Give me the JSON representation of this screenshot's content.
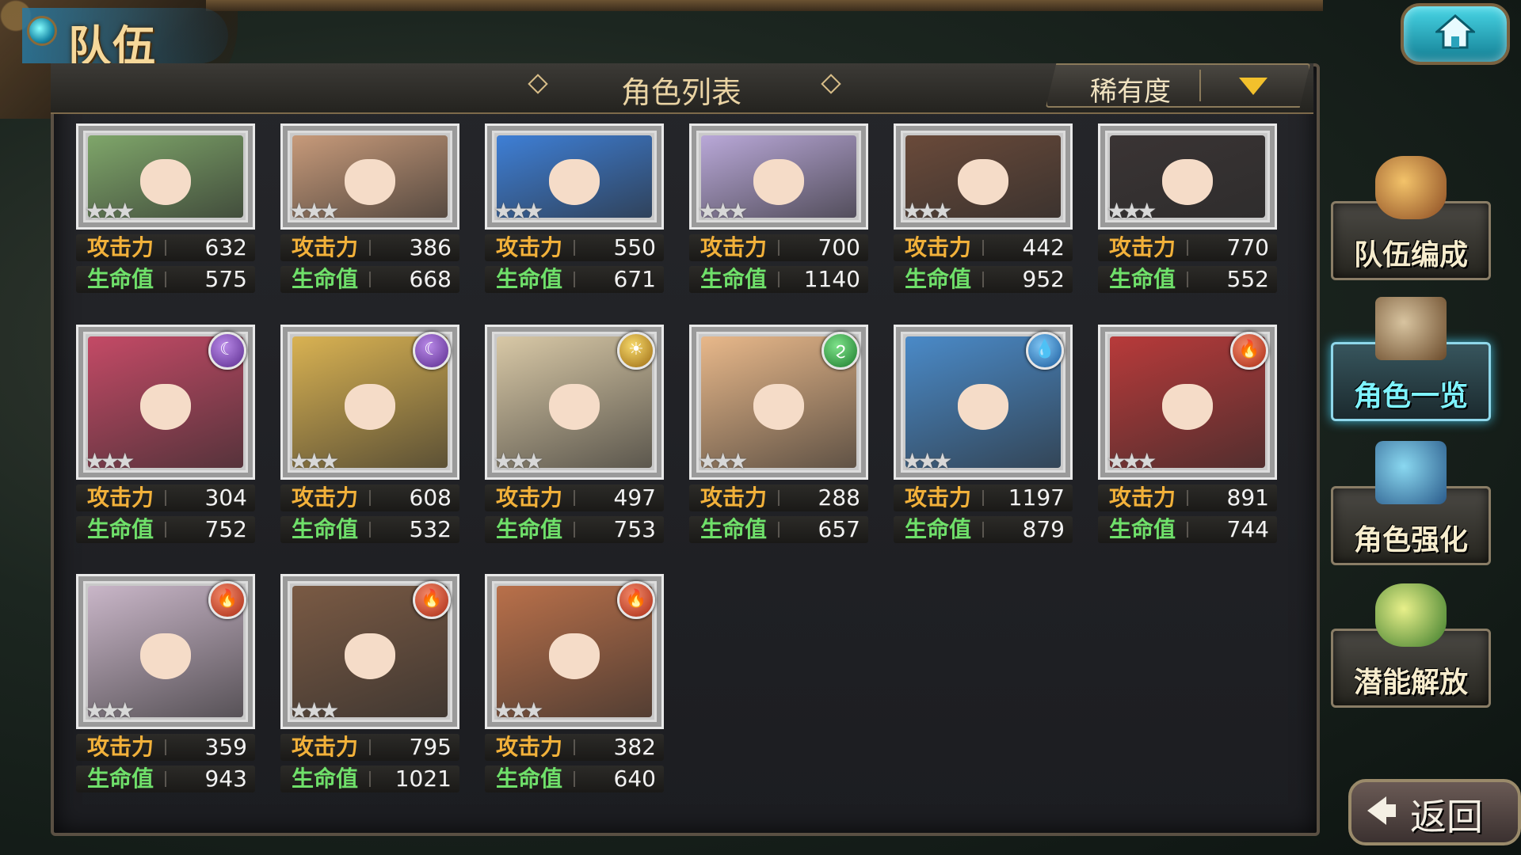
{
  "header": {
    "title": "队伍"
  },
  "panel": {
    "title": "角色列表",
    "sort_label": "稀有度"
  },
  "stat_labels": {
    "atk": "攻击力",
    "hp": "生命值"
  },
  "characters": [
    {
      "element": "none",
      "art": "#7fa66a",
      "atk": "632",
      "hp": "575"
    },
    {
      "element": "none",
      "art": "#c79a7a",
      "atk": "386",
      "hp": "668"
    },
    {
      "element": "none",
      "art": "#3e7fd6",
      "atk": "550",
      "hp": "671"
    },
    {
      "element": "none",
      "art": "#b9a8d8",
      "atk": "700",
      "hp": "1140"
    },
    {
      "element": "none",
      "art": "#6a4a3a",
      "atk": "442",
      "hp": "952"
    },
    {
      "element": "none",
      "art": "#3a3434",
      "atk": "770",
      "hp": "552"
    },
    {
      "element": "moon",
      "art": "#c44a66",
      "atk": "304",
      "hp": "752"
    },
    {
      "element": "moon",
      "art": "#d9b252",
      "atk": "608",
      "hp": "532"
    },
    {
      "element": "sun",
      "art": "#d8c8a6",
      "atk": "497",
      "hp": "753"
    },
    {
      "element": "wind",
      "art": "#e8b88a",
      "atk": "288",
      "hp": "657"
    },
    {
      "element": "water",
      "art": "#4a8ac8",
      "atk": "1197",
      "hp": "879"
    },
    {
      "element": "fire",
      "art": "#b83a3a",
      "atk": "891",
      "hp": "744"
    },
    {
      "element": "fire",
      "art": "#c9b6c8",
      "atk": "359",
      "hp": "943"
    },
    {
      "element": "fire",
      "art": "#7a5a44",
      "atk": "795",
      "hp": "1021"
    },
    {
      "element": "fire",
      "art": "#b9704a",
      "atk": "382",
      "hp": "640"
    }
  ],
  "side_menu": [
    {
      "label": "队伍编成",
      "active": false
    },
    {
      "label": "角色一览",
      "active": true
    },
    {
      "label": "角色强化",
      "active": false
    },
    {
      "label": "潜能解放",
      "active": false
    }
  ],
  "back": {
    "label": "返回"
  },
  "icons": {
    "home": "home-icon",
    "sort": "chevron-down-icon",
    "back": "arrow-left-icon",
    "moon": "moon-element-icon",
    "sun": "sun-element-icon",
    "wind": "wind-element-icon",
    "water": "water-element-icon",
    "fire": "fire-element-icon"
  },
  "colors": {
    "atk": "#f2b13a",
    "hp": "#6fe06a",
    "accent": "#7ef3ff",
    "gold": "#f6d89a"
  }
}
